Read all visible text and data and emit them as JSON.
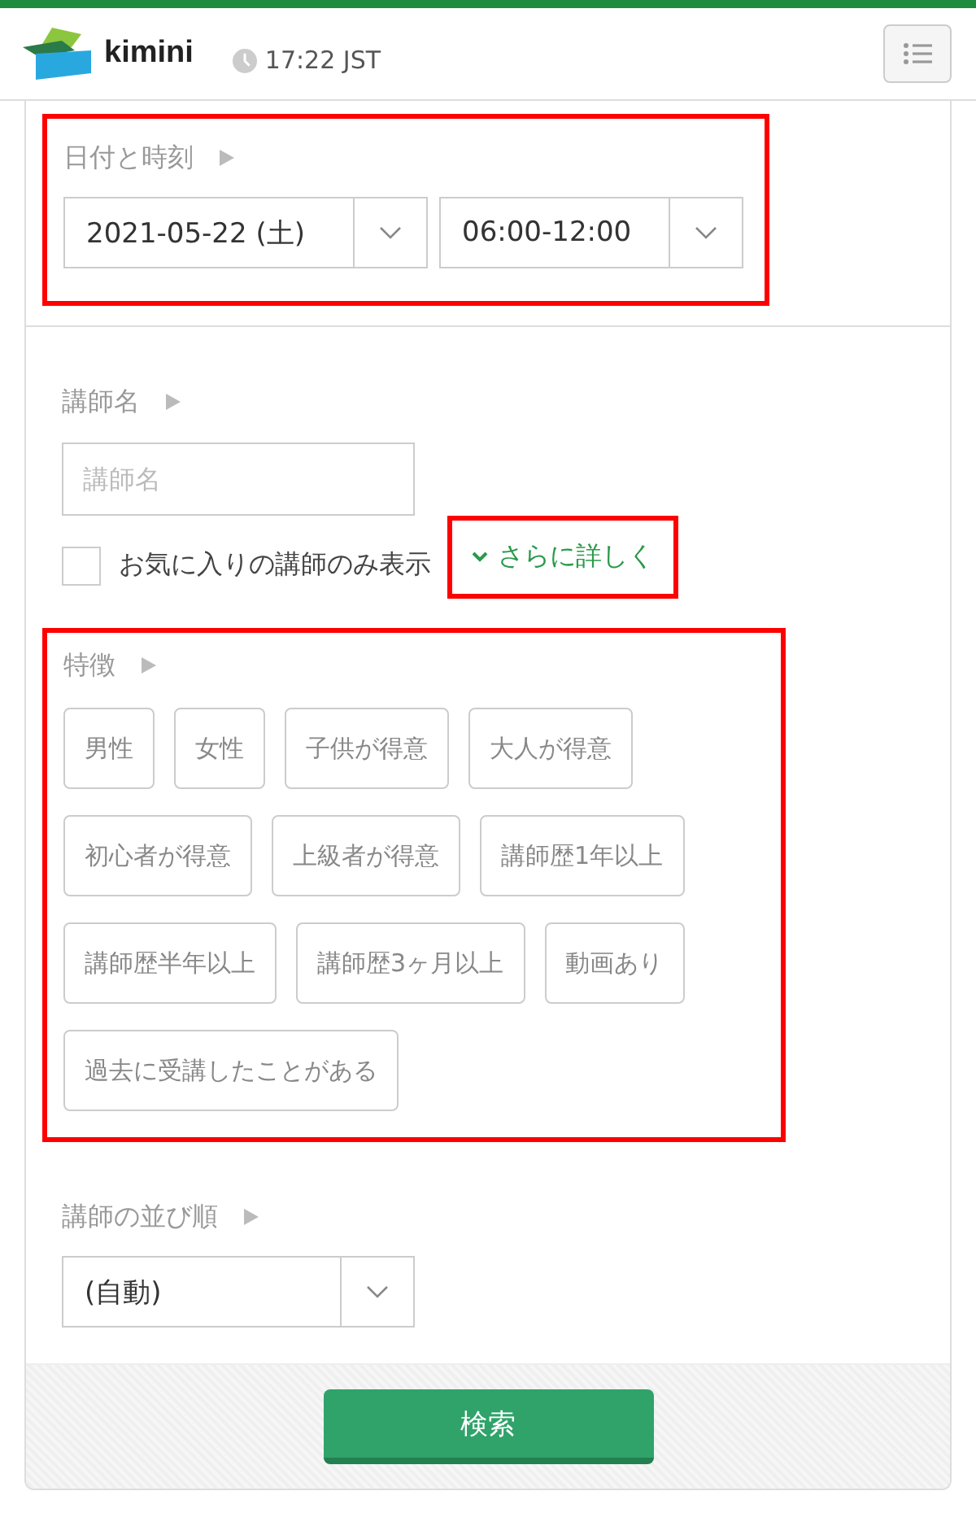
{
  "header": {
    "logo_text": "kimini",
    "time": "17:22 JST"
  },
  "date_section": {
    "highlighted": true,
    "label": "日付と時刻",
    "date": "2021-05-22 (土)",
    "time": "06:00-12:00"
  },
  "teacher_section": {
    "label": "講師名",
    "placeholder": "講師名",
    "favorites": {
      "label": "お気に入りの講師のみ表示",
      "checked": false
    },
    "more_link": {
      "label": "さらに詳しく",
      "highlighted": true
    }
  },
  "features_section": {
    "highlighted": true,
    "label": "特徴",
    "chips": [
      {
        "label": "男性",
        "selected": false
      },
      {
        "label": "女性",
        "selected": false
      },
      {
        "label": "子供が得意",
        "selected": false
      },
      {
        "label": "大人が得意",
        "selected": false
      },
      {
        "label": "初心者が得意",
        "selected": false
      },
      {
        "label": "上級者が得意",
        "selected": false
      },
      {
        "label": "講師歴1年以上",
        "selected": false
      },
      {
        "label": "講師歴半年以上",
        "selected": false
      },
      {
        "label": "講師歴3ヶ月以上",
        "selected": false
      },
      {
        "label": "動画あり",
        "selected": false
      },
      {
        "label": "過去に受講したことがある",
        "selected": false
      }
    ]
  },
  "sort_section": {
    "label": "講師の並び順",
    "value": "(自動)"
  },
  "search_button": "検索"
}
